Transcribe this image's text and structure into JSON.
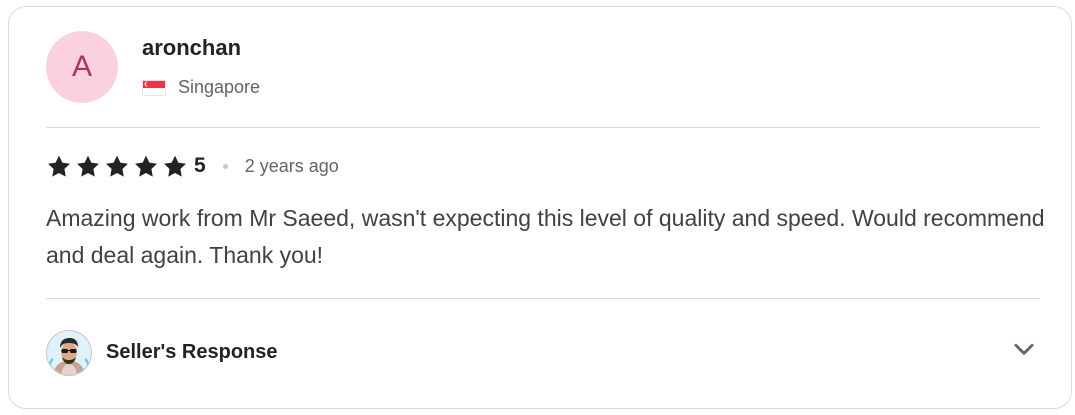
{
  "reviewer": {
    "avatar_letter": "A",
    "avatar_bg": "#fcd1df",
    "avatar_fg": "#b0325c",
    "username": "aronchan",
    "country": "Singapore",
    "flag_icon": "singapore-flag-icon"
  },
  "review": {
    "rating_stars": 5,
    "rating_value": "5",
    "time_ago": "2 years ago",
    "text": "Amazing work from Mr Saeed, wasn't expecting this level of quality and speed. Would recommend and deal again. Thank you!"
  },
  "seller_response": {
    "label": "Seller's Response",
    "avatar_icon": "seller-avatar-icon",
    "expand_icon": "chevron-down-icon"
  },
  "colors": {
    "star": "#222325",
    "divider": "#dadbdd",
    "muted_text": "#62646a"
  }
}
